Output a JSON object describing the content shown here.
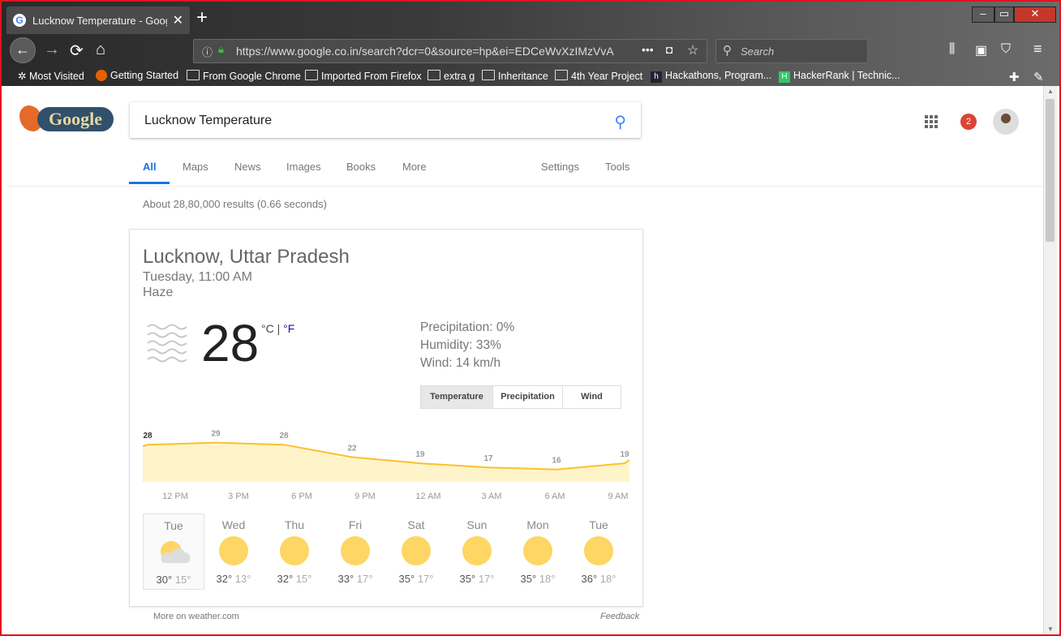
{
  "browser": {
    "tab_title": "Lucknow Temperature - Google Search",
    "tab_favicon": "G",
    "url": "https://www.google.co.in/search?dcr=0&source=hp&ei=EDCeWvXzIMzVvA",
    "search_placeholder": "Search",
    "bookmarks": [
      "Most Visited",
      "Getting Started",
      "From Google Chrome",
      "Imported From Firefox",
      "extra g",
      "Inheritance",
      "4th Year Project",
      "Hackathons, Program...",
      "HackerRank | Technic..."
    ],
    "accent": "#e3131b"
  },
  "google": {
    "logo_text": "Google",
    "query": "Lucknow Temperature",
    "notifications": "2",
    "tabs": [
      "All",
      "Maps",
      "News",
      "Images",
      "Books",
      "More"
    ],
    "right_tabs": [
      "Settings",
      "Tools"
    ],
    "stats": "About 28,80,000 results (0.66 seconds)"
  },
  "weather": {
    "location": "Lucknow, Uttar Pradesh",
    "time": "Tuesday, 11:00 AM",
    "condition": "Haze",
    "temperature": "28",
    "unit_c": "°C",
    "unit_sep": "|",
    "unit_f": "°F",
    "precipitation": "Precipitation: 0%",
    "humidity": "Humidity: 33%",
    "wind": "Wind: 14 km/h",
    "toggles": [
      "Temperature",
      "Precipitation",
      "Wind"
    ],
    "hour_labels": [
      "12 PM",
      "3 PM",
      "6 PM",
      "9 PM",
      "12 AM",
      "3 AM",
      "6 AM",
      "9 AM"
    ],
    "days": [
      {
        "name": "Tue",
        "high": "30°",
        "low": "15°",
        "icon": "partly-cloudy-icon"
      },
      {
        "name": "Wed",
        "high": "32°",
        "low": "13°",
        "icon": "sun-icon"
      },
      {
        "name": "Thu",
        "high": "32°",
        "low": "15°",
        "icon": "sun-icon"
      },
      {
        "name": "Fri",
        "high": "33°",
        "low": "17°",
        "icon": "sun-icon"
      },
      {
        "name": "Sat",
        "high": "35°",
        "low": "17°",
        "icon": "sun-icon"
      },
      {
        "name": "Sun",
        "high": "35°",
        "low": "17°",
        "icon": "sun-icon"
      },
      {
        "name": "Mon",
        "high": "35°",
        "low": "18°",
        "icon": "sun-icon"
      },
      {
        "name": "Tue",
        "high": "36°",
        "low": "18°",
        "icon": "sun-icon"
      }
    ],
    "more": "More on weather.com",
    "feedback": "Feedback"
  },
  "chart_data": {
    "type": "area",
    "x": [
      "12 PM",
      "3 PM",
      "6 PM",
      "9 PM",
      "12 AM",
      "3 AM",
      "6 AM",
      "9 AM"
    ],
    "values": [
      28,
      29,
      28,
      22,
      19,
      17,
      16,
      19
    ],
    "line_color": "#fbc02d",
    "fill_color": "#fff4c9"
  }
}
